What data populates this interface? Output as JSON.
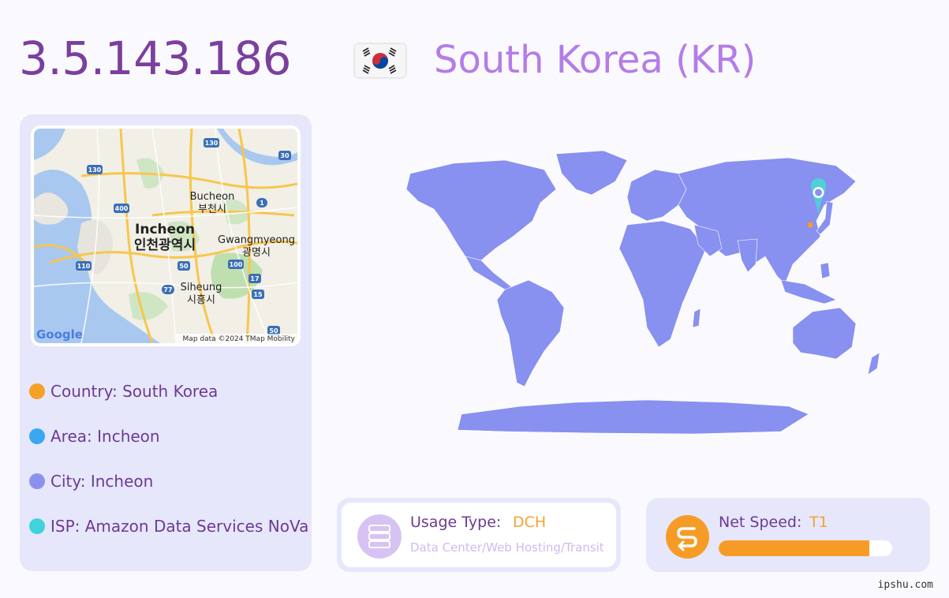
{
  "header": {
    "ip": "3.5.143.186",
    "country_title": "South Korea (KR)",
    "flag_icon": "south-korea-flag-icon"
  },
  "map": {
    "labels": {
      "bucheon_en": "Bucheon",
      "bucheon_ko": "부천시",
      "incheon_en": "Incheon",
      "incheon_ko": "인천광역시",
      "gwangmyeong_en": "Gwangmyeong",
      "gwangmyeong_ko": "광명시",
      "siheung_en": "Siheung",
      "siheung_ko": "시흥시"
    },
    "route_shields": [
      "130",
      "130",
      "400",
      "110",
      "50",
      "77",
      "100",
      "17",
      "15",
      "1",
      "30",
      "50"
    ],
    "google_logo": "Google",
    "attribution": "Map data ©2024 TMap Mobility"
  },
  "info": [
    {
      "label": "Country: South Korea",
      "color": "#f5a026"
    },
    {
      "label": "Area: Incheon",
      "color": "#3aa7f2"
    },
    {
      "label": "City: Incheon",
      "color": "#8b92ee"
    },
    {
      "label": "ISP: Amazon Data Services NoVa",
      "color": "#3fd3dc"
    }
  ],
  "usage": {
    "label": "Usage Type:",
    "value": "DCH",
    "description": "Data Center/Web Hosting/Transit",
    "icon": "server-icon"
  },
  "speed": {
    "label": "Net Speed:",
    "value": "T1",
    "fill_percent": 87,
    "icon": "speed-icon"
  },
  "footer": {
    "site": "ipshu.com"
  },
  "colors": {
    "world_land": "#8890f0",
    "marker": "#4fcfd9",
    "accent_orange": "#f69c26"
  }
}
